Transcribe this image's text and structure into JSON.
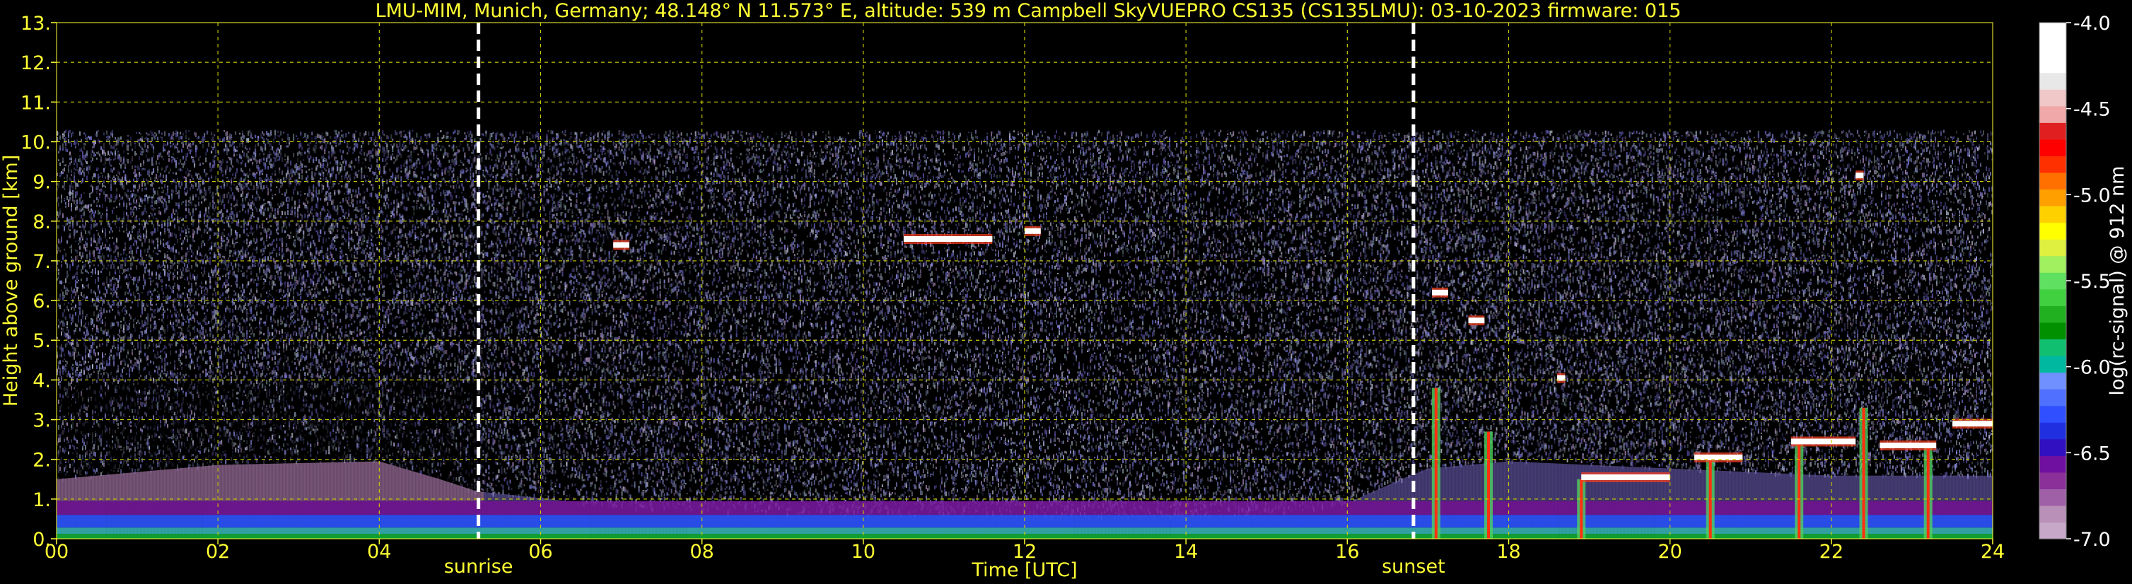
{
  "chart_data": {
    "type": "heatmap",
    "title": "LMU-MIM, Munich, Germany; 48.148° N 11.573° E, altitude: 539 m    Campbell SkyVUEPRO CS135 (CS135LMU): 03-10-2023    firmware: 015",
    "xlabel": "Time [UTC]",
    "ylabel": "Height above ground [km]",
    "xlim": [
      0,
      24
    ],
    "ylim": [
      0,
      13
    ],
    "x_ticks": [
      "00",
      "02",
      "04",
      "06",
      "08",
      "10",
      "12",
      "14",
      "16",
      "18",
      "20",
      "22",
      "24"
    ],
    "x_tick_values": [
      0,
      2,
      4,
      6,
      8,
      10,
      12,
      14,
      16,
      18,
      20,
      22,
      24
    ],
    "y_ticks": [
      "0.",
      "1.",
      "2.",
      "3.",
      "4.",
      "5.",
      "6.",
      "7.",
      "8.",
      "9.",
      "10.",
      "11.",
      "12.",
      "13."
    ],
    "y_tick_values": [
      0,
      1,
      2,
      3,
      4,
      5,
      6,
      7,
      8,
      9,
      10,
      11,
      12,
      13
    ],
    "grid": true,
    "events": [
      {
        "label": "sunrise",
        "time": 5.23
      },
      {
        "label": "sunset",
        "time": 16.82
      }
    ],
    "colorbar": {
      "label": "log(rc-signal) @ 912 nm",
      "range": [
        -7.0,
        -4.0
      ],
      "ticks": [
        "-4.0",
        "-4.5",
        "-5.0",
        "-5.5",
        "-6.0",
        "-6.5",
        "-7.0"
      ],
      "tick_values": [
        -4.0,
        -4.5,
        -5.0,
        -5.5,
        -6.0,
        -6.5,
        -7.0
      ],
      "colors": [
        "#c8a8c8",
        "#b890b8",
        "#a060a8",
        "#8a3098",
        "#7010a0",
        "#3010c0",
        "#2030e0",
        "#3050ff",
        "#5070ff",
        "#7090ff",
        "#00b8a0",
        "#10c070",
        "#009000",
        "#20b020",
        "#40d040",
        "#60e060",
        "#a0f060",
        "#e0f040",
        "#ffff00",
        "#ffd000",
        "#ffa000",
        "#ff7000",
        "#ff3000",
        "#ff0000",
        "#e02020",
        "#f0a8a8",
        "#f0c8c8",
        "#e8e8e8",
        "#ffffff",
        "#ffffff",
        "#ffffff"
      ]
    },
    "signal_features": {
      "noise_top_km": 10.3,
      "boundary_layer_top_km": [
        [
          0,
          1.5
        ],
        [
          2,
          1.9
        ],
        [
          4,
          2.0
        ],
        [
          5.2,
          1.2
        ],
        [
          7,
          0.8
        ],
        [
          10,
          0.6
        ],
        [
          13,
          0.55
        ],
        [
          15,
          0.6
        ],
        [
          16,
          0.9
        ],
        [
          17,
          1.8
        ],
        [
          18,
          2.0
        ],
        [
          20,
          1.8
        ],
        [
          22,
          1.6
        ],
        [
          24,
          1.6
        ]
      ],
      "cloud_segments": [
        {
          "t": [
            6.9,
            7.1
          ],
          "h": 7.4
        },
        {
          "t": [
            10.5,
            11.6
          ],
          "h": 7.55
        },
        {
          "t": [
            12.0,
            12.2
          ],
          "h": 7.75
        },
        {
          "t": [
            17.05,
            17.25
          ],
          "h": 6.2
        },
        {
          "t": [
            17.5,
            17.7
          ],
          "h": 5.5
        },
        {
          "t": [
            18.6,
            18.7
          ],
          "h": 4.05
        },
        {
          "t": [
            18.9,
            20.0
          ],
          "h": 1.55
        },
        {
          "t": [
            20.3,
            20.9
          ],
          "h": 2.05
        },
        {
          "t": [
            21.5,
            22.3
          ],
          "h": 2.45
        },
        {
          "t": [
            22.3,
            22.4
          ],
          "h": 9.15
        },
        {
          "t": [
            22.6,
            23.3
          ],
          "h": 2.35
        },
        {
          "t": [
            23.5,
            24.0
          ],
          "h": 2.9
        }
      ],
      "precipitation_columns": [
        [
          17.1,
          3.8
        ],
        [
          17.75,
          2.7
        ],
        [
          18.9,
          1.5
        ],
        [
          20.5,
          2.0
        ],
        [
          21.6,
          2.4
        ],
        [
          22.4,
          3.3
        ],
        [
          23.2,
          2.3
        ]
      ]
    }
  }
}
